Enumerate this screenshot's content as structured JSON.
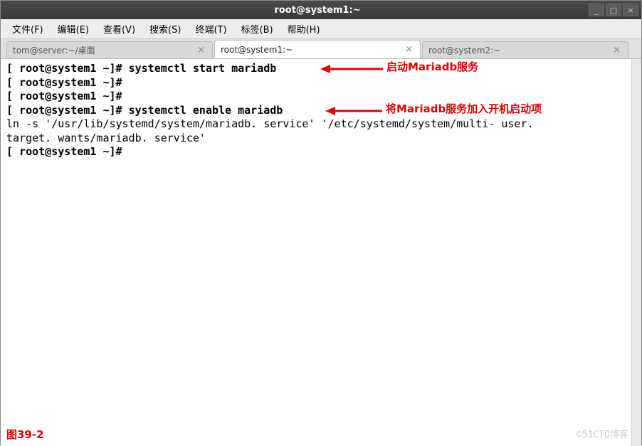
{
  "window": {
    "title": "root@system1:~"
  },
  "menu": {
    "items": [
      "文件(F)",
      "编辑(E)",
      "查看(V)",
      "搜索(S)",
      "终端(T)",
      "标签(B)",
      "帮助(H)"
    ]
  },
  "tabs": [
    {
      "label": "tom@server:~/桌面",
      "active": false
    },
    {
      "label": "root@system1:~",
      "active": true
    },
    {
      "label": "root@system2:~",
      "active": false
    }
  ],
  "terminal": {
    "lines": [
      "[ root@system1 ~]# systemctl start mariadb",
      "[ root@system1 ~]#",
      "[ root@system1 ~]#",
      "[ root@system1 ~]# systemctl enable mariadb",
      "ln -s '/usr/lib/systemd/system/mariadb. service' '/etc/systemd/system/multi- user.",
      "target. wants/mariadb. service'",
      "[ root@system1 ~]#"
    ]
  },
  "annotations": {
    "a1": "启动Mariadb服务",
    "a2": "将Mariadb服务加入开机启动项"
  },
  "figure_label": "图39-2",
  "watermark": "©51CTO博客"
}
